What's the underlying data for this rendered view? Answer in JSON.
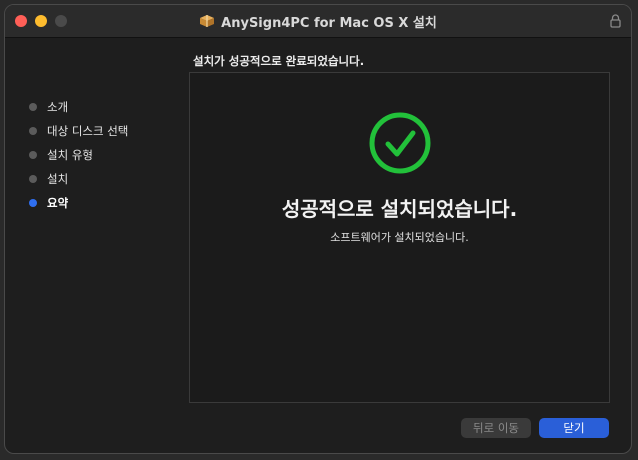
{
  "window": {
    "title": "AnySign4PC for Mac OS X 설치"
  },
  "header": {
    "status": "설치가 성공적으로 완료되었습니다."
  },
  "sidebar": {
    "steps": [
      {
        "label": "소개",
        "active": false
      },
      {
        "label": "대상 디스크 선택",
        "active": false
      },
      {
        "label": "설치 유형",
        "active": false
      },
      {
        "label": "설치",
        "active": false
      },
      {
        "label": "요약",
        "active": true
      }
    ]
  },
  "main": {
    "title": "성공적으로 설치되었습니다.",
    "subtitle": "소프트웨어가 설치되었습니다.",
    "icon": "checkmark-circle-icon"
  },
  "buttons": {
    "back_label": "뒤로 이동",
    "close_label": "닫기"
  },
  "colors": {
    "accent": "#2a5fd8",
    "success": "#22c13a",
    "active_step": "#2f6ff0"
  }
}
